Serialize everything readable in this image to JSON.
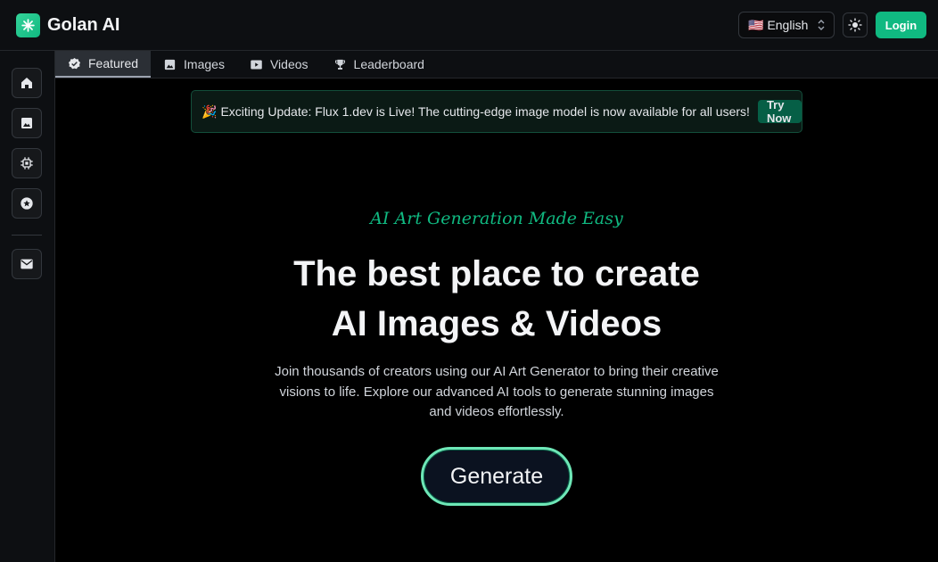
{
  "header": {
    "brand": "Golan AI",
    "language": {
      "flag": "🇺🇸",
      "label": "English"
    },
    "theme_icon": "sun-icon",
    "login_label": "Login"
  },
  "sidebar": {
    "items": [
      {
        "icon": "home-icon"
      },
      {
        "icon": "image-icon"
      },
      {
        "icon": "chip-icon"
      },
      {
        "icon": "star-badge-icon"
      },
      {
        "icon": "mail-icon"
      }
    ]
  },
  "tabs": [
    {
      "label": "Featured",
      "icon": "verified-badge-icon",
      "active": true
    },
    {
      "label": "Images",
      "icon": "image-icon"
    },
    {
      "label": "Videos",
      "icon": "video-icon"
    },
    {
      "label": "Leaderboard",
      "icon": "trophy-icon"
    }
  ],
  "banner": {
    "emoji": "🎉",
    "text": "Exciting Update: Flux 1.dev is Live! The cutting-edge image model is now available for all users!",
    "button": "Try Now"
  },
  "hero": {
    "tagline": "AI Art Generation Made Easy",
    "title_line1": "The best place to create",
    "title_line2": "AI Images & Videos",
    "description": "Join thousands of creators using our AI Art Generator to bring their creative visions to life. Explore our advanced AI tools to generate stunning images and videos effortlessly.",
    "cta": "Generate"
  },
  "colors": {
    "accent": "#10b981",
    "background": "#000000",
    "panel": "#0d0f12"
  }
}
